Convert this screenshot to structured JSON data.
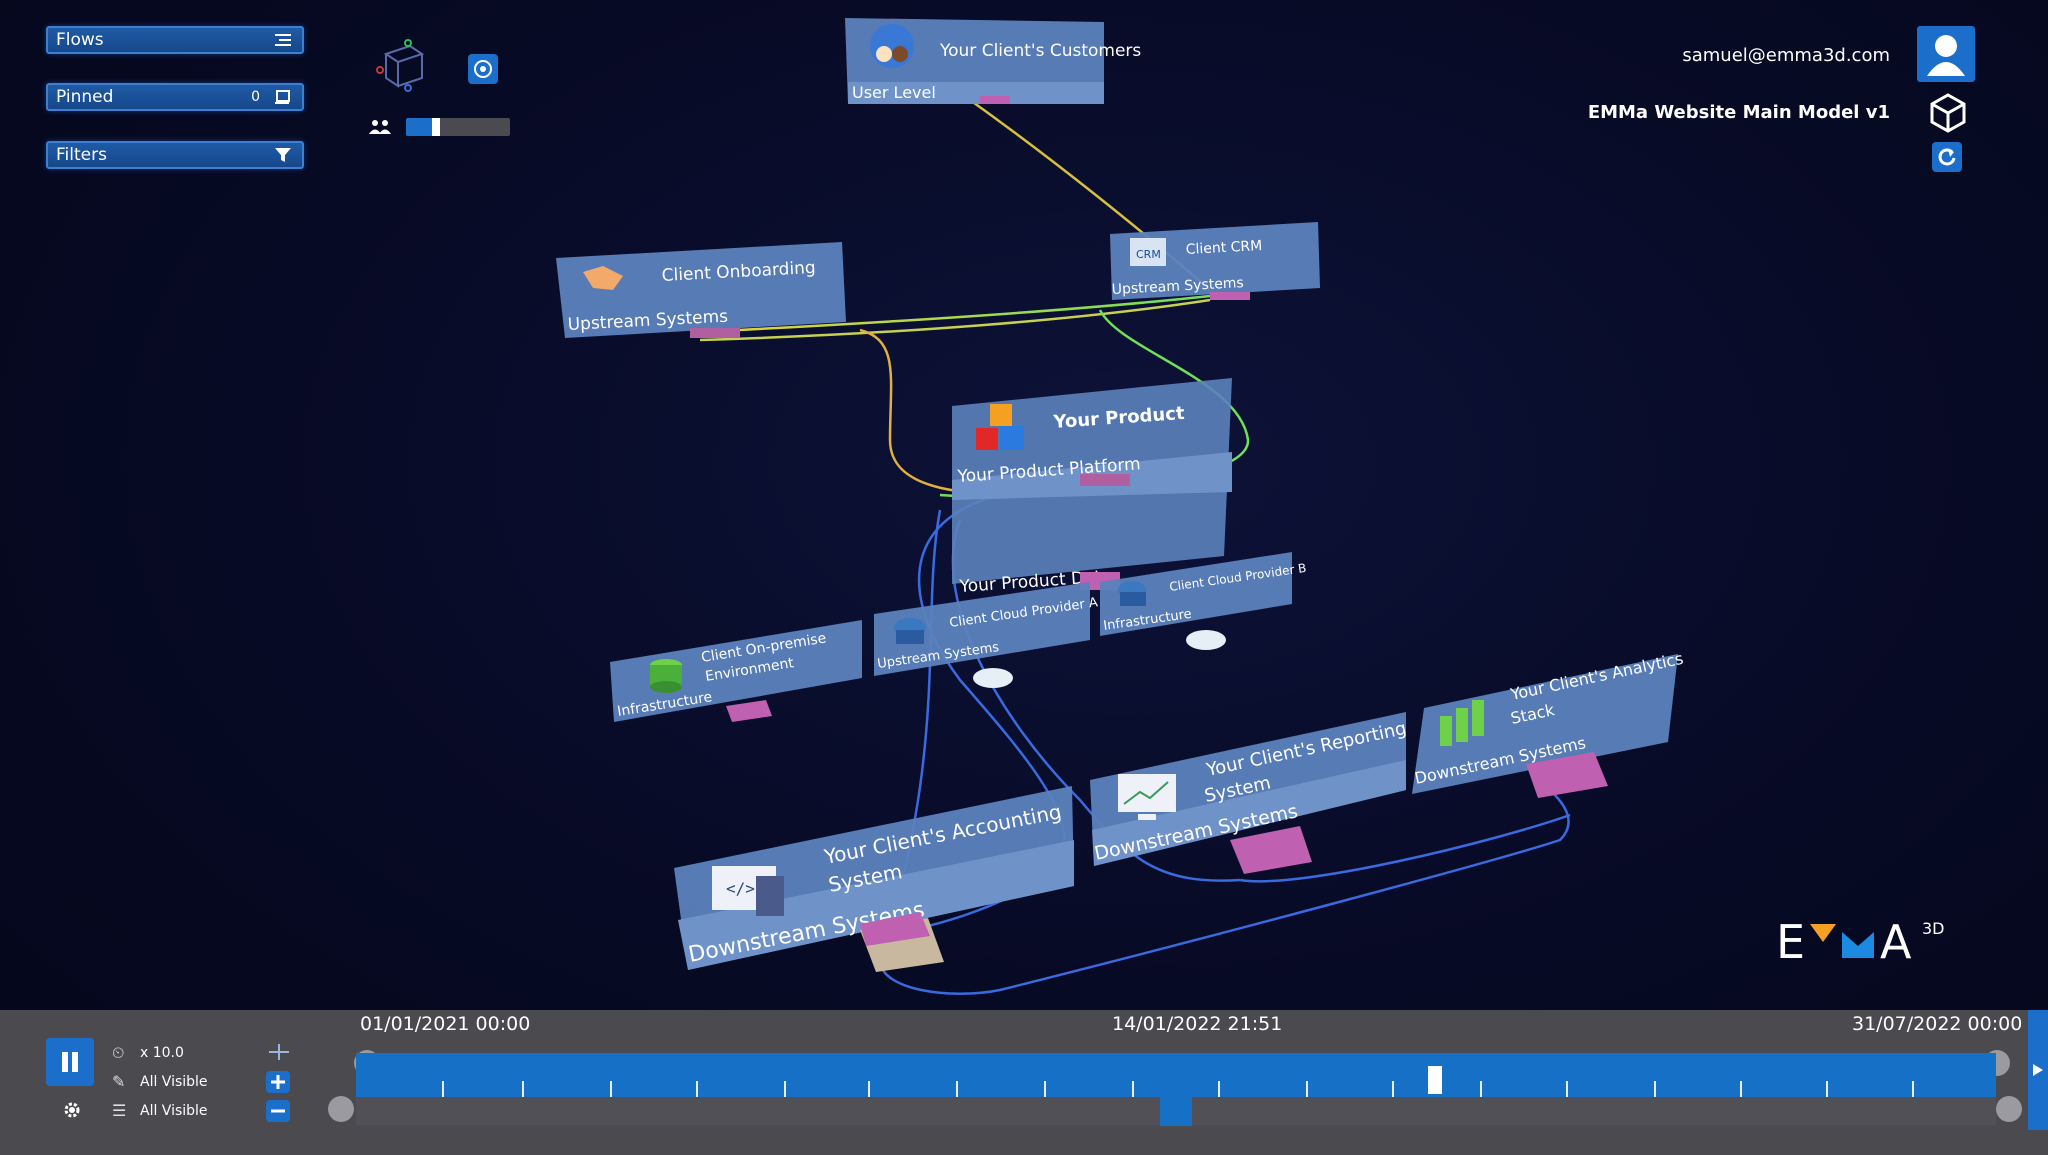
{
  "sidebar": {
    "flows_label": "Flows",
    "pinned_label": "Pinned",
    "pinned_count": "0",
    "filters_label": "Filters"
  },
  "user": {
    "email": "samuel@emma3d.com",
    "model_name": "EMMa Website Main Model v1"
  },
  "logo": {
    "text": "EMMA",
    "superscript": "3D"
  },
  "nodes": {
    "customers": {
      "title": "Your Client's Customers",
      "layer": "User Level"
    },
    "onboarding": {
      "title": "Client Onboarding",
      "layer": "Upstream Systems"
    },
    "crm": {
      "title": "Client CRM",
      "icon_text": "CRM",
      "layer": "Upstream Systems"
    },
    "product": {
      "title": "Your Product",
      "layer": "Your Product Platform",
      "data_layer": "Your Product Data"
    },
    "onprem": {
      "title_line1": "Client On-premise",
      "title_line2": "Environment",
      "layer": "Infrastructure"
    },
    "cloud_a": {
      "title": "Client Cloud Provider A",
      "layer": "Upstream Systems"
    },
    "cloud_b": {
      "title": "Client Cloud Provider B",
      "layer": "Infrastructure"
    },
    "accounting": {
      "title_line1": "Your Client's Accounting",
      "title_line2": "System",
      "layer": "Downstream Systems"
    },
    "reporting": {
      "title_line1": "Your Client's Reporting",
      "title_line2": "System",
      "layer": "Downstream Systems"
    },
    "analytics": {
      "title_line1": "Your Client's Analytics",
      "title_line2": "Stack",
      "layer": "Downstream Systems"
    }
  },
  "timeline": {
    "start": "01/01/2021 00:00",
    "current": "14/01/2022 21:51",
    "end": "31/07/2022 00:00",
    "speed": "x 10.0",
    "visibility_1": "All Visible",
    "visibility_2": "All Visible",
    "progress": 0.45,
    "track_color": "#1670c6"
  },
  "colors": {
    "accent": "#1b6fca",
    "card": "#5b82bd",
    "background": "#070a24"
  }
}
